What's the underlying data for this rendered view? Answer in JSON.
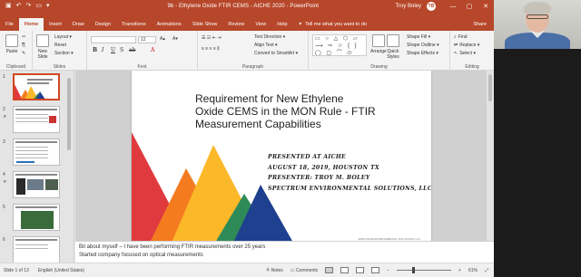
{
  "window": {
    "title": "9b - Ethylene Oxide FTIR CEMS - AICHE 2020  -  PowerPoint",
    "user_name": "Troy Boley",
    "user_initials": "TB",
    "quick_access": [
      "save-icon",
      "undo-icon",
      "redo-icon",
      "present-icon"
    ],
    "controls": [
      "—",
      "▢",
      "✕"
    ]
  },
  "ribbon": {
    "tabs": [
      "File",
      "Home",
      "Insert",
      "Draw",
      "Design",
      "Transitions",
      "Animations",
      "Slide Show",
      "Review",
      "View",
      "Help"
    ],
    "active_tab": "Home",
    "tell_me": "Tell me what you want to do",
    "share": "Share",
    "clipboard": {
      "label": "Clipboard",
      "paste": "Paste"
    },
    "slides": {
      "label": "Slides",
      "new_slide": "New\nSlide",
      "layout": "Layout ▾",
      "reset": "Reset",
      "section": "Section ▾"
    },
    "font": {
      "label": "Font",
      "size": "12",
      "buttons": [
        "B",
        "I",
        "U",
        "S",
        "ab",
        "A"
      ]
    },
    "paragraph": {
      "label": "Paragraph",
      "text_direction": "Text Direction ▾",
      "align_text": "Align Text ▾",
      "smartart": "Convert to SmartArt ▾"
    },
    "drawing": {
      "label": "Drawing",
      "shapes": "▭ ○ △ ⬡ ▱ ⟶ ⇨ ☆ { } ◯ ▢ ⌒ ⬭",
      "arrange": "Arrange",
      "quick_styles": "Quick\nStyles",
      "shape_fill": "Shape Fill ▾",
      "shape_outline": "Shape Outline ▾",
      "shape_effects": "Shape Effects ▾"
    },
    "editing": {
      "label": "Editing",
      "find": "Find",
      "replace": "Replace ▾",
      "select": "Select ▾"
    }
  },
  "thumbnails": [
    {
      "num": "1",
      "selected": true
    },
    {
      "num": "2",
      "selected": false
    },
    {
      "num": "3",
      "selected": false
    },
    {
      "num": "4",
      "selected": false
    },
    {
      "num": "5",
      "selected": false
    },
    {
      "num": "6",
      "selected": false
    }
  ],
  "slide": {
    "title_lines": [
      "Requirement for New Ethylene",
      "Oxide CEMS in the MON Rule - FTIR",
      "Measurement Capabilities"
    ],
    "presenter_lines": [
      "PRESENTED AT AICHE",
      "AUGUST 18, 2019, HOUSTON TX",
      "PRESENTER: TROY M. BOLEY",
      "SPECTRUM ENVIRONMENTAL SOLUTIONS, LLC"
    ],
    "footer": "SPECTRUM ENVIRONMENTAL SOLUTIONS, LLC",
    "colors": {
      "red": "#e03a3e",
      "orange": "#f47b20",
      "yellow": "#fbb829",
      "green": "#2e8b57",
      "blue": "#1f3f8f"
    }
  },
  "notes": {
    "lines": [
      "Bit about myself – I have been performing FTIR measurements over 25 years",
      "Started company focused on optical measurements"
    ]
  },
  "status": {
    "slide_of": "Slide 1 of 13",
    "language": "English (United States)",
    "notes": "Notes",
    "comments": "Comments",
    "zoom": "61%",
    "zoom_level": 0.61
  },
  "colors": {
    "accent": "#b7472a",
    "selection": "#d24726"
  }
}
